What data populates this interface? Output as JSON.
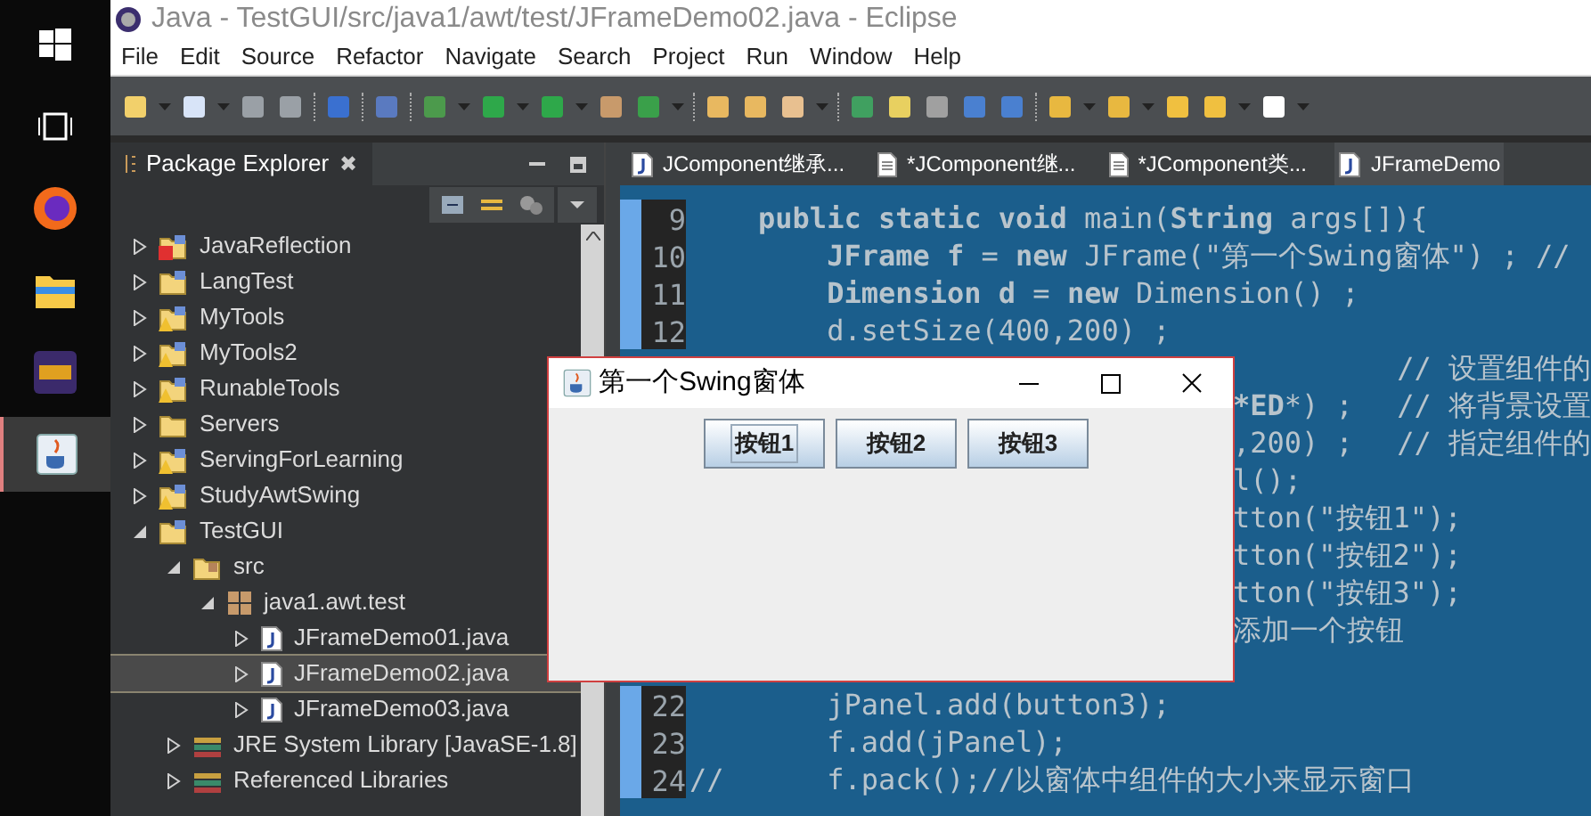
{
  "window": {
    "title": "Java - TestGUI/src/java1/awt/test/JFrameDemo02.java - Eclipse"
  },
  "menu": [
    "File",
    "Edit",
    "Source",
    "Refactor",
    "Navigate",
    "Search",
    "Project",
    "Run",
    "Window",
    "Help"
  ],
  "taskbar": [
    {
      "kind": "windows",
      "selected": false
    },
    {
      "kind": "taskview",
      "selected": false
    },
    {
      "kind": "firefox",
      "selected": false
    },
    {
      "kind": "explorer",
      "selected": false
    },
    {
      "kind": "game",
      "selected": false
    },
    {
      "kind": "java",
      "selected": true
    }
  ],
  "package_explorer": {
    "title": "Package Explorer",
    "close": "✖",
    "tree": [
      {
        "label": "JavaReflection",
        "kind": "project",
        "error": true,
        "warning": false,
        "expanded": false,
        "selected": false
      },
      {
        "label": "LangTest",
        "kind": "project",
        "error": false,
        "warning": false,
        "expanded": false,
        "selected": false
      },
      {
        "label": "MyTools",
        "kind": "project",
        "error": false,
        "warning": true,
        "expanded": false,
        "selected": false
      },
      {
        "label": "MyTools2",
        "kind": "project",
        "error": false,
        "warning": true,
        "expanded": false,
        "selected": false
      },
      {
        "label": "RunableTools",
        "kind": "project",
        "error": false,
        "warning": true,
        "expanded": false,
        "selected": false
      },
      {
        "label": "Servers",
        "kind": "folder",
        "error": false,
        "warning": false,
        "expanded": false,
        "selected": false
      },
      {
        "label": "ServingForLearning",
        "kind": "project",
        "error": false,
        "warning": true,
        "expanded": false,
        "selected": false
      },
      {
        "label": "StudyAwtSwing",
        "kind": "project",
        "error": false,
        "warning": true,
        "expanded": false,
        "selected": false
      },
      {
        "label": "TestGUI",
        "kind": "project",
        "error": false,
        "warning": false,
        "expanded": true,
        "selected": false,
        "children": [
          {
            "label": "src",
            "kind": "source",
            "expanded": true,
            "selected": false,
            "children": [
              {
                "label": "java1.awt.test",
                "kind": "package",
                "expanded": true,
                "selected": false,
                "children": [
                  {
                    "label": "JFrameDemo01.java",
                    "kind": "java",
                    "expanded": false,
                    "selected": false
                  },
                  {
                    "label": "JFrameDemo02.java",
                    "kind": "java",
                    "expanded": false,
                    "selected": true
                  },
                  {
                    "label": "JFrameDemo03.java",
                    "kind": "java",
                    "expanded": false,
                    "selected": false
                  }
                ]
              }
            ]
          },
          {
            "label": "JRE System Library [JavaSE-1.8]",
            "kind": "library",
            "expanded": false,
            "selected": false
          },
          {
            "label": "Referenced Libraries",
            "kind": "library",
            "expanded": false,
            "selected": false
          }
        ]
      }
    ]
  },
  "editor": {
    "tabs": [
      {
        "label": "JComponent继承...",
        "kind": "java",
        "selected": false
      },
      {
        "label": "*JComponent继...",
        "kind": "text",
        "selected": false
      },
      {
        "label": "*JComponent类...",
        "kind": "text",
        "selected": false
      },
      {
        "label": "JFrameDemo",
        "kind": "java",
        "selected": true
      }
    ],
    "lines_above": [
      {
        "number": "9",
        "text": "    **public static void** main(**String** args[]){"
      },
      {
        "number": "10",
        "text": "        **JFrame f** = **new** JFrame(\"第一个Swing窗体\") ; //"
      },
      {
        "number": "11",
        "text": "        **Dimension d** = **new** Dimension() ;"
      },
      {
        "number": "12",
        "text": "        d.setSize(400,200) ;"
      }
    ],
    "lines_beside_window": [
      {
        "kind": "right",
        "segments": [
          "// 设置组件的"
        ]
      },
      {
        "kind": "split",
        "segments": [
          "***ED***) ;",
          "// 将背景设置"
        ]
      },
      {
        "kind": "split",
        "segments": [
          ",200) ;",
          "// 指定组件的"
        ]
      },
      {
        "kind": "left",
        "segments": [
          "l();"
        ]
      },
      {
        "kind": "left",
        "segments": [
          "tton(\"按钮1\");"
        ]
      },
      {
        "kind": "left",
        "segments": [
          "tton(\"按钮2\");"
        ]
      },
      {
        "kind": "left",
        "segments": [
          "tton(\"按钮3\");"
        ]
      },
      {
        "kind": "left",
        "segments": [
          "添加一个按钮"
        ]
      }
    ],
    "lines_below": [
      {
        "number": "22",
        "text": "        jPanel.add(button3);"
      },
      {
        "number": "23",
        "text": "        f.add(jPanel);"
      },
      {
        "number": "24",
        "text": "//      f.pack();//以窗体中组件的大小来显示窗口"
      }
    ]
  },
  "swing_window": {
    "title": "第一个Swing窗体",
    "buttons": [
      {
        "label": "按钮1",
        "focused": true
      },
      {
        "label": "按钮2",
        "focused": false
      },
      {
        "label": "按钮3",
        "focused": false
      }
    ]
  }
}
